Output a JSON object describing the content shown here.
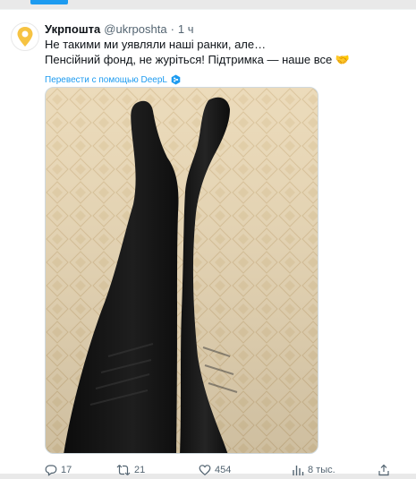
{
  "tweet": {
    "display_name": "Укрпошта",
    "handle": "@ukrposhta",
    "separator": "·",
    "timestamp": "1 ч",
    "text_line_1": "Не такими ми уявляли наші ранки, але…",
    "text_line_2": "Пенсійний фонд, не журіться! Підтримка — наше все 🤝",
    "translate_label": "Перевести с помощью DeepL",
    "media": {
      "description": "photo",
      "colors": {
        "wall": "#e9d7b4",
        "tights": "#141414"
      }
    }
  },
  "actions": {
    "reply_count": "17",
    "retweet_count": "21",
    "like_count": "454",
    "views_count": "8 тыс."
  },
  "colors": {
    "accent": "#1d9bf0",
    "text_primary": "#0f1419",
    "text_secondary": "#536471",
    "avatar_brand": "#f6c342"
  },
  "icons": {
    "avatar": "ukrposhta-logo",
    "translate": "deepl-icon",
    "reply": "reply-icon",
    "retweet": "retweet-icon",
    "like": "heart-icon",
    "views": "views-icon",
    "share": "share-icon"
  }
}
